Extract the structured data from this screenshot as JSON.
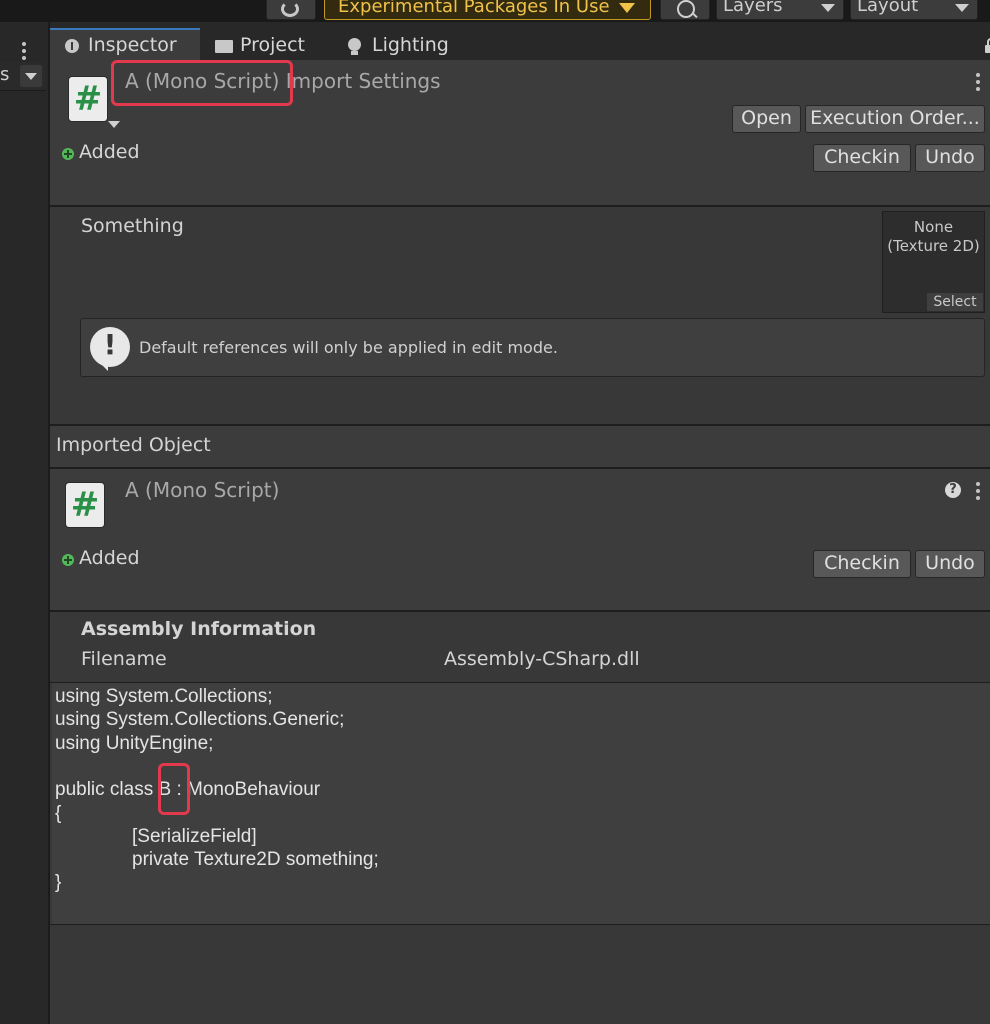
{
  "toolbar": {
    "experimental_label": "Experimental Packages In Use",
    "layers_label": "Layers",
    "layout_label": "Layout"
  },
  "left_pane": {
    "search_text": "s"
  },
  "tabs": [
    {
      "label": "Inspector",
      "icon": "info-icon",
      "active": true
    },
    {
      "label": "Project",
      "icon": "folder-icon",
      "active": false
    },
    {
      "label": "Lighting",
      "icon": "bulb-icon",
      "active": false
    }
  ],
  "header": {
    "script_icon": "#",
    "title_part1": "A (Mono Script)",
    "title_part2": " Import Settings",
    "status": "Added",
    "buttons": {
      "open": "Open",
      "execution_order": "Execution Order...",
      "checkin": "Checkin",
      "undo": "Undo"
    }
  },
  "settings": {
    "field_label": "Something",
    "object_value": "None\n(Texture 2D)",
    "select_label": "Select",
    "help_message": "Default references will only be applied in edit mode."
  },
  "imported_object": {
    "section_title": "Imported Object",
    "script_icon": "#",
    "title": "A (Mono Script)",
    "status": "Added",
    "buttons": {
      "checkin": "Checkin",
      "undo": "Undo"
    }
  },
  "assembly": {
    "heading": "Assembly Information",
    "filename_label": "Filename",
    "filename_value": "Assembly-CSharp.dll"
  },
  "code": {
    "line1": "using System.Collections;",
    "line2": "using System.Collections.Generic;",
    "line3": "using UnityEngine;",
    "line5a": "public class ",
    "class_name": "B",
    "line5b": " : MonoBehaviour",
    "line6": "{",
    "line7": "[SerializeField]",
    "line8": "private Texture2D something;",
    "line9": "}"
  },
  "colors": {
    "accent_highlight": "#e23a4c",
    "warning_gold": "#f0c24a",
    "added_green": "#55b858"
  }
}
